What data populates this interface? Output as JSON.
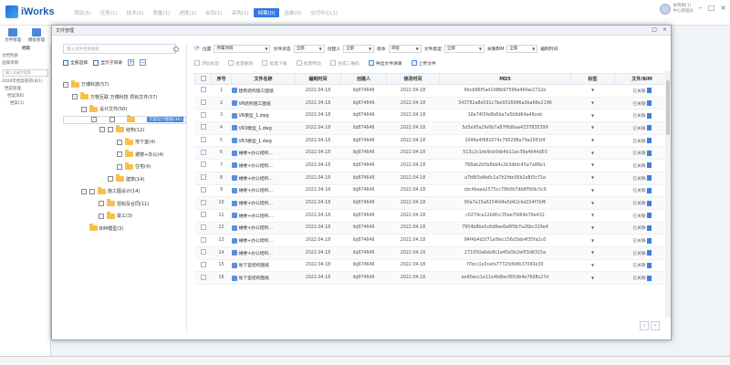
{
  "app": {
    "logo_text": "iWorks",
    "nav": [
      "项目(5)",
      "任务(1)",
      "技术(1)",
      "质量(1)",
      "进度(1)",
      "合同(1)",
      "采购(1)",
      "档案(0)",
      "运维(0)",
      "交付中心(1)"
    ],
    "active_nav_index": 7,
    "user_name": "张晓明(1)",
    "user_role": "中心管理员",
    "toolbar_buttons": [
      "文件管理",
      "模板管理"
    ],
    "left_panel": {
      "title": "档案",
      "rows": [
        "文档列表",
        "选择项目:",
        "2020年档案卷宗(8/1)",
        "档案管理",
        "档案资料",
        "档案(1)"
      ],
      "search_placeholder": "输入关键字搜索"
    }
  },
  "dialog": {
    "title": "文件管理",
    "search_placeholder": "输入文件名称搜索",
    "left_actions": [
      "全部选择",
      "显示子目录"
    ],
    "tree": [
      {
        "label": "万博科技(57)",
        "level": 0,
        "expander": "-",
        "checkbox": false
      },
      {
        "label": "万物互联 万博科技 项目文件(57)",
        "level": 1,
        "expander": "-",
        "checkbox": false
      },
      {
        "label": "设计文件(50)",
        "level": 2,
        "expander": "-",
        "checkbox": false
      },
      {
        "label": "方案设计图纸(36)",
        "level": 3,
        "expander": "-",
        "checkbox": true,
        "selected": true
      },
      {
        "label": "结构(12)",
        "level": 4,
        "expander": "-",
        "checkbox": true
      },
      {
        "label": "地下室(4)",
        "level": 5,
        "expander": "",
        "checkbox": true
      },
      {
        "label": "裙楼+办公(4)",
        "level": 5,
        "expander": "",
        "checkbox": true
      },
      {
        "label": "住宅(4)",
        "level": 5,
        "expander": "",
        "checkbox": true
      },
      {
        "label": "建筑(14)",
        "level": 4,
        "expander": "",
        "checkbox": true
      },
      {
        "label": "施工图设计(14)",
        "level": 2,
        "expander": "-",
        "checkbox": true
      },
      {
        "label": "招标及合同(11)",
        "level": 3,
        "expander": "",
        "checkbox": true
      },
      {
        "label": "竣工(3)",
        "level": 3,
        "expander": "",
        "checkbox": true
      },
      {
        "label": "BIM模型(3)",
        "level": 2,
        "expander": "",
        "checkbox": false
      }
    ],
    "filters": {
      "location_label": "位置",
      "location_value": "所属项目",
      "status_label": "文件状态",
      "status_value": "全部",
      "creator_label": "创建人",
      "creator_value": "全部",
      "version_label": "版本",
      "version_value": "单版",
      "type_label": "文件类型",
      "type_value": "全部",
      "tag_label": "关联BIM",
      "tag_value": "全部",
      "extra_label": "编制时间"
    },
    "tools": [
      {
        "label": "添加标签",
        "enabled": false
      },
      {
        "label": "批量删除",
        "enabled": false
      },
      {
        "label": "批量下载",
        "enabled": false
      },
      {
        "label": "批量移动",
        "enabled": false
      },
      {
        "label": "生成二维码",
        "enabled": false
      },
      {
        "label": "导出文件清单",
        "enabled": true
      },
      {
        "label": "上传文件",
        "enabled": true
      }
    ],
    "columns": [
      "",
      "序号",
      "文件名称",
      "编制时间",
      "创建人",
      "修改时间",
      "MD5",
      "标签",
      "文件/BIM"
    ],
    "rows": [
      {
        "no": "1",
        "name": "建筑结构施工图纸",
        "date": "2022.04.18",
        "creator": "ibj874646",
        "mdate": "2022.04.18",
        "md5": "6bcb96f5ad1fd8b97596e46fae2722e",
        "bim": "已关联"
      },
      {
        "no": "2",
        "name": "VR结构施工图纸",
        "date": "2022.04.18",
        "creator": "ibj874646",
        "mdate": "2022.04.18",
        "md5": "343782a8e591c7be9316996a3ba66e2196",
        "bim": "已关联"
      },
      {
        "no": "3",
        "name": "VR模型_1.dwg",
        "date": "2022.04.18",
        "creator": "ibj874646",
        "mdate": "2022.04.18",
        "md5": "18a74f3fe6b6ba7a5b9d64a48ceb",
        "bim": "已关联"
      },
      {
        "no": "4",
        "name": "VR3模型_1.dwg",
        "date": "2022.04.18",
        "creator": "ibj874646",
        "mdate": "2022.04.18",
        "md5": "5d5e95a2fe0b7a87f6d6aa4337835399",
        "bim": "已关联"
      },
      {
        "no": "5",
        "name": "VR3模型_1.dwg",
        "date": "2022.04.18",
        "creator": "ibj874646",
        "mdate": "2022.04.18",
        "md5": "2046e4f682074c795298a79a2061f4",
        "bim": "已关联"
      },
      {
        "no": "6",
        "name": "裙楼+办公结构...",
        "date": "2022.04.18",
        "creator": "ibj874646",
        "mdate": "2022.04.18",
        "md5": "513c2c1de9cb0db4b11ec39a4644d50",
        "bim": "已关联"
      },
      {
        "no": "7",
        "name": "裙楼+办公结构...",
        "date": "2022.04.18",
        "creator": "ibj874646",
        "mdate": "2022.04.18",
        "md5": "768ab2b5b8bb4c2b3dbfc45a7a88e1",
        "bim": "已关联"
      },
      {
        "no": "8",
        "name": "裙楼+办公结构...",
        "date": "2022.04.18",
        "creator": "ibj874646",
        "mdate": "2022.04.18",
        "md5": "a7b8f3d4e6c1a7b2fde56b2e8f3c71e",
        "bim": "已关联"
      },
      {
        "no": "9",
        "name": "裙楼+办公结构...",
        "date": "2022.04.18",
        "creator": "ibj874646",
        "mdate": "2022.04.18",
        "md5": "cbc4baaa2575cc78b0b7db8f5b9c5c0",
        "bim": "已关联"
      },
      {
        "no": "10",
        "name": "裙楼+办公结构...",
        "date": "2022.04.18",
        "creator": "ibj874646",
        "mdate": "2022.04.18",
        "md5": "90a7a15a6154fd4e5d42cbd154f7bf6",
        "bim": "已关联"
      },
      {
        "no": "11",
        "name": "裙楼+办公结构...",
        "date": "2022.04.18",
        "creator": "ibj874646",
        "mdate": "2022.04.18",
        "md5": "c0274ca12b9fcc35ee7fd64e79e432",
        "bim": "已关联"
      },
      {
        "no": "12",
        "name": "裙楼+办公结构...",
        "date": "2022.04.18",
        "creator": "ibj874646",
        "mdate": "2022.04.18",
        "md5": "7954b8be5c6d8ee6a8f0b7a26bc316e4",
        "bim": "已关联"
      },
      {
        "no": "13",
        "name": "裙楼+办公结构...",
        "date": "2022.04.18",
        "creator": "ibj874646",
        "mdate": "2022.04.18",
        "md5": "84f4b4d2f71af9ec156d3eb4f35fa1c0",
        "bim": "已关联"
      },
      {
        "no": "14",
        "name": "裙楼+办公结构...",
        "date": "2022.04.18",
        "creator": "ibj874646",
        "mdate": "2022.04.18",
        "md5": "271050a6eb8c1e45e5b2e0f3d6315a",
        "bim": "已关联"
      },
      {
        "no": "15",
        "name": "地下室结构图纸",
        "date": "2022.04.18",
        "creator": "ibj874646",
        "mdate": "2022.04.18",
        "md5": "f7bcc1e3cafa77720d94b37043e30",
        "bim": "已关联"
      },
      {
        "no": "16",
        "name": "地下室结构图纸",
        "date": "2022.04.18",
        "creator": "ibj874646",
        "mdate": "2022.04.18",
        "md5": "ae90acc1e11e4b8be365db4e7698c27d",
        "bim": "已关联"
      }
    ]
  }
}
